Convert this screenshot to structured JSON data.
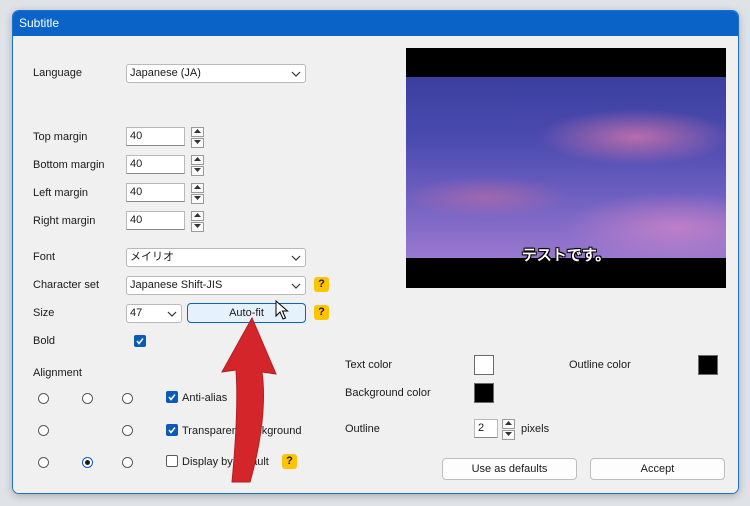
{
  "window": {
    "title": "Subtitle"
  },
  "labels": {
    "language": "Language",
    "top_margin": "Top margin",
    "bottom_margin": "Bottom margin",
    "left_margin": "Left margin",
    "right_margin": "Right margin",
    "font": "Font",
    "character_set": "Character set",
    "size": "Size",
    "bold": "Bold",
    "alignment": "Alignment",
    "text_color": "Text color",
    "outline_color": "Outline color",
    "background_color": "Background color",
    "outline": "Outline",
    "pixels": "pixels"
  },
  "values": {
    "language": "Japanese (JA)",
    "top_margin": "40",
    "bottom_margin": "40",
    "left_margin": "40",
    "right_margin": "40",
    "font": "メイリオ",
    "character_set": "Japanese Shift-JIS",
    "size": "47",
    "outline": "2"
  },
  "checkboxes": {
    "bold": true,
    "anti_alias": {
      "label": "Anti-alias",
      "checked": true
    },
    "transparent_background": {
      "label": "Transparent background",
      "checked": true
    },
    "display_by_default": {
      "label": "Display by default",
      "checked": false
    }
  },
  "alignment": {
    "selected": "bottom-center"
  },
  "colors": {
    "text": "#ffffff",
    "outline": "#000000",
    "background": "#000000",
    "accent": "#0a64c8",
    "help": "#ffc400"
  },
  "buttons": {
    "auto_fit": "Auto-fit",
    "use_as_defaults": "Use as defaults",
    "accept": "Accept"
  },
  "help": {
    "glyph": "?"
  },
  "preview": {
    "subtitle_text": "テストです。"
  }
}
